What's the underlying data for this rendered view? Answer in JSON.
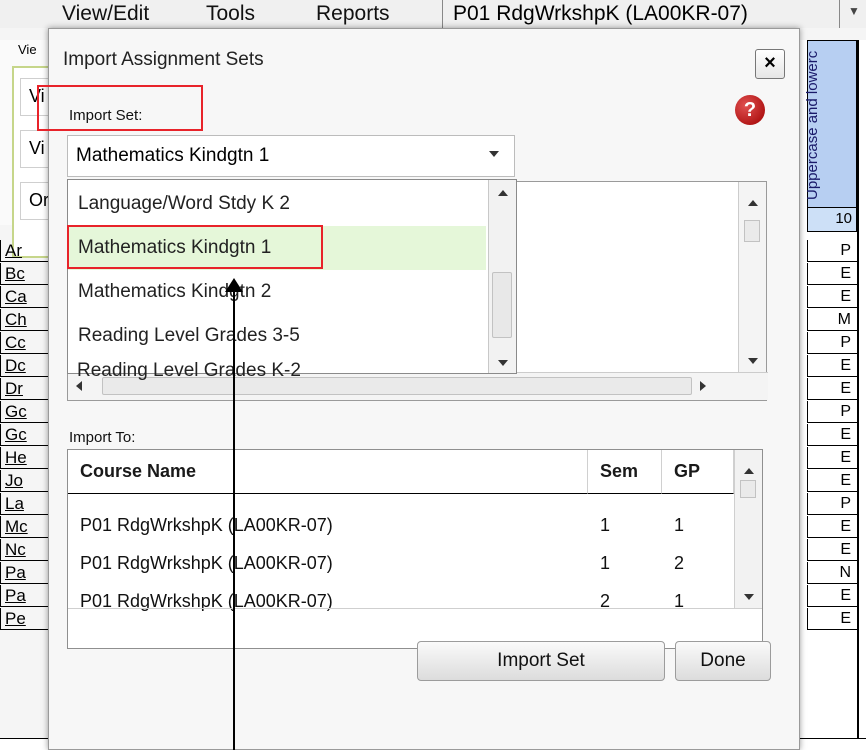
{
  "menubar": {
    "items": [
      "View/Edit",
      "Tools",
      "Reports"
    ],
    "course_selector": "P01   RdgWrkshpK (LA00KR-07)"
  },
  "left_panel": {
    "view_label": "Vie",
    "options": [
      "Vi",
      "Vi",
      "Or"
    ]
  },
  "student_names": [
    "Ar",
    "Bc",
    "Ca",
    "Ch",
    "Cc",
    "Dc",
    "Dr",
    "Gc",
    "Gc",
    "He",
    "Jo",
    "La",
    "Mc",
    "Nc",
    "Pa",
    "Pa",
    "Pe"
  ],
  "right_column": {
    "header": "Uppercase and lowerc",
    "max_points": "10",
    "grades": [
      "P",
      "E",
      "E",
      "M",
      "P",
      "E",
      "E",
      "P",
      "E",
      "E",
      "E",
      "P",
      "E",
      "E",
      "N",
      "E",
      "E"
    ]
  },
  "dialog": {
    "title": "Import Assignment Sets",
    "close_label": "×",
    "help_label": "?",
    "import_set_label": "Import Set:",
    "import_set_value": "Mathematics Kindgtn 1",
    "dropdown_options": [
      "Language/Word Stdy K 2",
      "Mathematics Kindgtn 1",
      "Mathematics Kindgtn 2",
      "Reading Level Grades 3-5",
      "Reading Level Grades K-2"
    ],
    "selected_option": "Mathematics Kindgtn 1",
    "import_to_label": "Import To:",
    "table": {
      "columns": [
        "Course Name",
        "Sem",
        "GP"
      ],
      "rows": [
        [
          "P01   RdgWrkshpK (LA00KR-07)",
          "1",
          "1"
        ],
        [
          "P01   RdgWrkshpK (LA00KR-07)",
          "1",
          "2"
        ],
        [
          "P01   RdgWrkshpK (LA00KR-07)",
          "2",
          "1"
        ]
      ]
    },
    "import_button": "Import Set",
    "done_button": "Done"
  },
  "colors": {
    "selection_highlight": "#e5f7d9",
    "annotation_outline": "#e8232a",
    "header_blue": "#b7cff2",
    "help_red": "#b80000"
  }
}
